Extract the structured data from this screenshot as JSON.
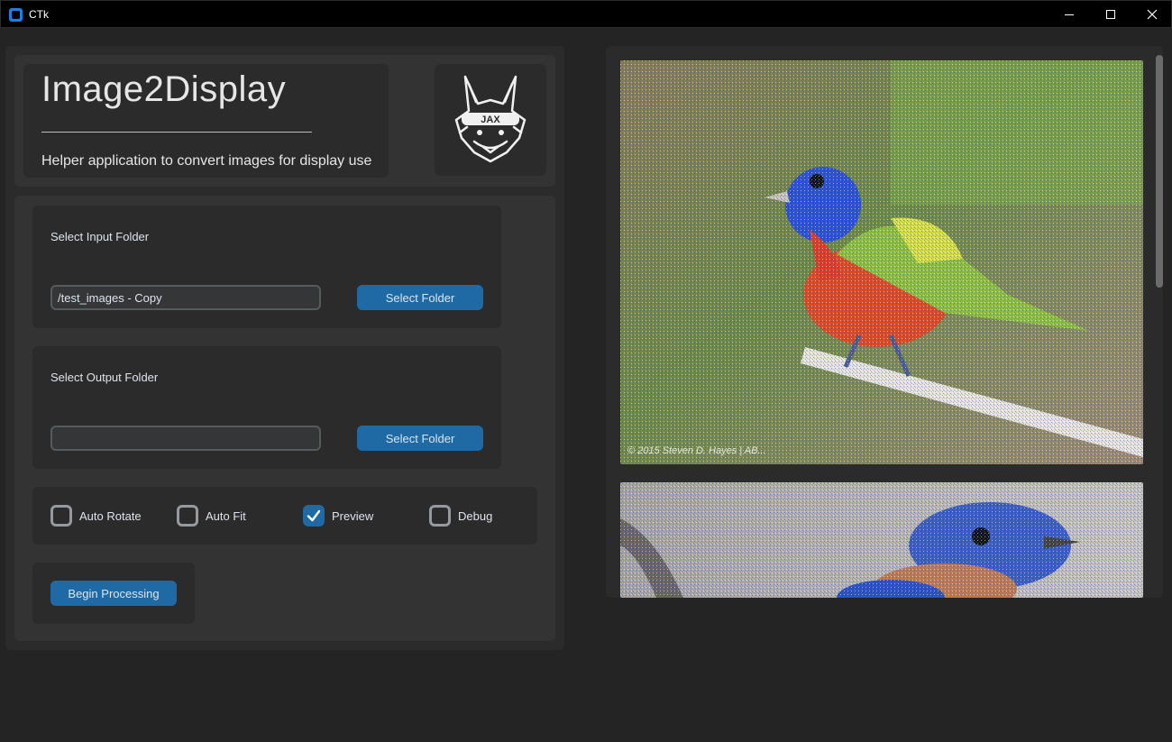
{
  "window": {
    "title": "CTk"
  },
  "header": {
    "app_title": "Image2Display",
    "subtitle": "Helper application to convert images for display use",
    "logo_text": "JAX"
  },
  "input_folder": {
    "label": "Select Input Folder",
    "value": "/test_images - Copy",
    "placeholder": "",
    "button": "Select Folder"
  },
  "output_folder": {
    "label": "Select Output Folder",
    "value": "",
    "placeholder": "",
    "button": "Select Folder"
  },
  "options": [
    {
      "label": "Auto Rotate",
      "checked": false
    },
    {
      "label": "Auto Fit",
      "checked": false
    },
    {
      "label": "Preview",
      "checked": true
    },
    {
      "label": "Debug",
      "checked": false
    }
  ],
  "actions": {
    "begin_processing": "Begin Processing"
  },
  "preview": {
    "watermark": "© 2015 Steven D. Hayes | AB..."
  },
  "colors": {
    "accent": "#1f6aa5",
    "background": "#242424",
    "panel": "#2b2b2b",
    "frame": "#333333"
  }
}
